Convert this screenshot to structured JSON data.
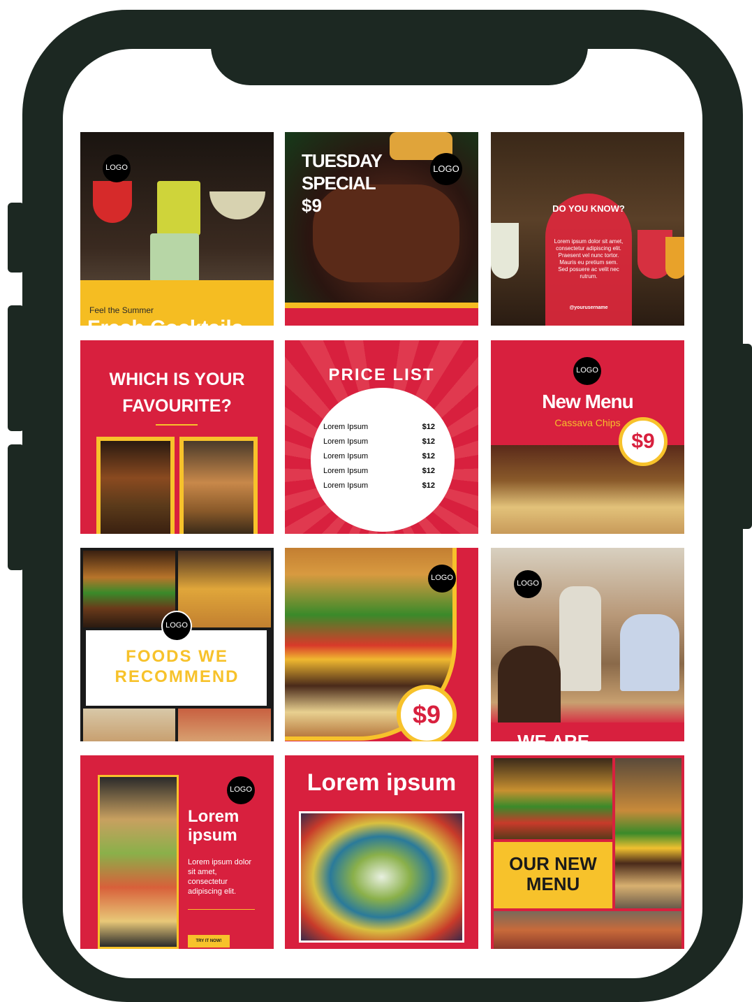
{
  "tiles": {
    "t1": {
      "logo": "LOGO",
      "tagline": "Feel the Summer",
      "headline": "Fresh Cocktails"
    },
    "t2": {
      "line1": "TUESDAY",
      "line2": "SPECIAL",
      "price": "$9",
      "logo": "LOGO"
    },
    "t3": {
      "heading": "DO YOU KNOW?",
      "body": "Lorem ipsum dolor sit amet, consectetur adipiscing elit. Praesent vel nunc tortor. Mauris eu pretium sem. Sed posuere ac velit nec rutrum.",
      "username": "@yourusername"
    },
    "t4": {
      "line1": "WHICH IS YOUR",
      "line2": "FAVOURITE?"
    },
    "t5": {
      "heading": "PRICE LIST",
      "items": [
        {
          "name": "Lorem Ipsum",
          "price": "$12"
        },
        {
          "name": "Lorem Ipsum",
          "price": "$12"
        },
        {
          "name": "Lorem Ipsum",
          "price": "$12"
        },
        {
          "name": "Lorem Ipsum",
          "price": "$12"
        },
        {
          "name": "Lorem Ipsum",
          "price": "$12"
        }
      ]
    },
    "t6": {
      "logo": "LOGO",
      "title": "New Menu",
      "subtitle": "Cassava Chips",
      "price": "$9"
    },
    "t7": {
      "logo": "LOGO",
      "line1": "FOODS WE",
      "line2": "RECOMMEND"
    },
    "t8": {
      "logo": "LOGO",
      "price": "$9"
    },
    "t9": {
      "logo": "LOGO",
      "caption": "WE ARE"
    },
    "t10": {
      "logo": "LOGO",
      "title1": "Lorem",
      "title2": "ipsum",
      "body": "Lorem ipsum dolor sit amet, consectetur adipiscing elit.",
      "cta": "TRY IT NOW!"
    },
    "t11": {
      "title": "Lorem ipsum"
    },
    "t12": {
      "line1": "OUR NEW",
      "line2": "MENU"
    }
  },
  "colors": {
    "brand_red": "#d8203e",
    "brand_yellow": "#f7c22b",
    "phone_frame": "#1c2822"
  }
}
